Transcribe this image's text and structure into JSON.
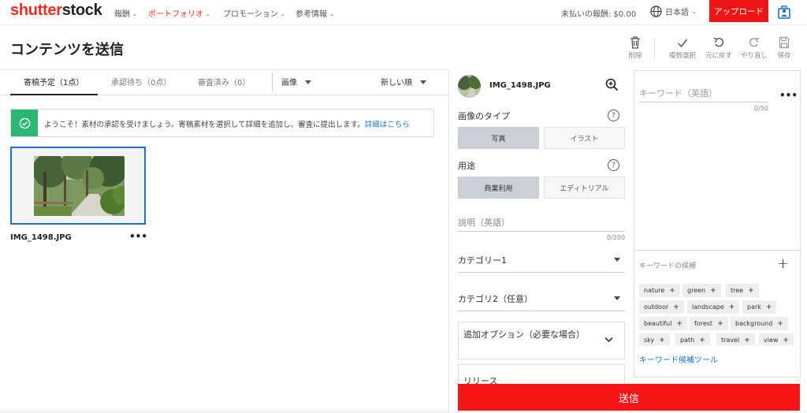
{
  "brand": {
    "logo_part1": "shutter",
    "logo_part2": "stock"
  },
  "topnav": {
    "items": [
      {
        "label": "報酬"
      },
      {
        "label": "ポートフォリオ"
      },
      {
        "label": "プロモーション"
      },
      {
        "label": "参考情報"
      }
    ],
    "earnings": "未払いの報酬: $0.00",
    "language": "日本語",
    "upload_label": "アップロード"
  },
  "page": {
    "title": "コンテンツを送信"
  },
  "toolbar": {
    "delete": "削除",
    "multi_select": "複数選択",
    "undo": "元に戻す",
    "redo": "やり直し",
    "save": "保存"
  },
  "tabs": {
    "items": [
      {
        "label": "寄稿予定（1点）"
      },
      {
        "label": "承認待ち（0点）"
      },
      {
        "label": "審査済み（0）"
      }
    ],
    "type_filter": "画像",
    "sort": "新しい順"
  },
  "banner": {
    "text": "ようこそ！素材の承認を受けましょう。寄稿素材を選択して詳細を追加し、審査に提出します。",
    "link": "詳細はこちら"
  },
  "asset": {
    "filename": "IMG_1498.JPG",
    "more": "•••"
  },
  "details": {
    "filename": "IMG_1498.JPG",
    "image_type_label": "画像のタイプ",
    "image_type_options": [
      "写真",
      "イラスト"
    ],
    "image_type_selected": "写真",
    "usage_label": "用途",
    "usage_options": [
      "商業利用",
      "エディトリアル"
    ],
    "usage_selected": "商業利用",
    "description_placeholder": "説明（英語）",
    "description_counter": "0/200",
    "category1": "カテゴリー1",
    "category2": "カテゴリ2（任意）",
    "extra_options": "追加オプション（必要な場合）",
    "release": "リリース",
    "help": "?"
  },
  "keywords": {
    "placeholder": "キーワード（英語）",
    "counter": "0/50",
    "more": "•••",
    "suggest_title": "キーワードの候補",
    "suggest_add": "+",
    "tags": [
      "nature",
      "green",
      "tree",
      "outdoor",
      "landscape",
      "park",
      "beautiful",
      "forest",
      "background",
      "sky",
      "path",
      "travel",
      "view"
    ],
    "tool_link": "キーワード候補ツール"
  },
  "submit_label": "送信",
  "colors": {
    "brand_red": "#ee2b24",
    "submit_red": "#f71616",
    "success_green": "#2bb673",
    "link_blue": "#1a73c8"
  }
}
